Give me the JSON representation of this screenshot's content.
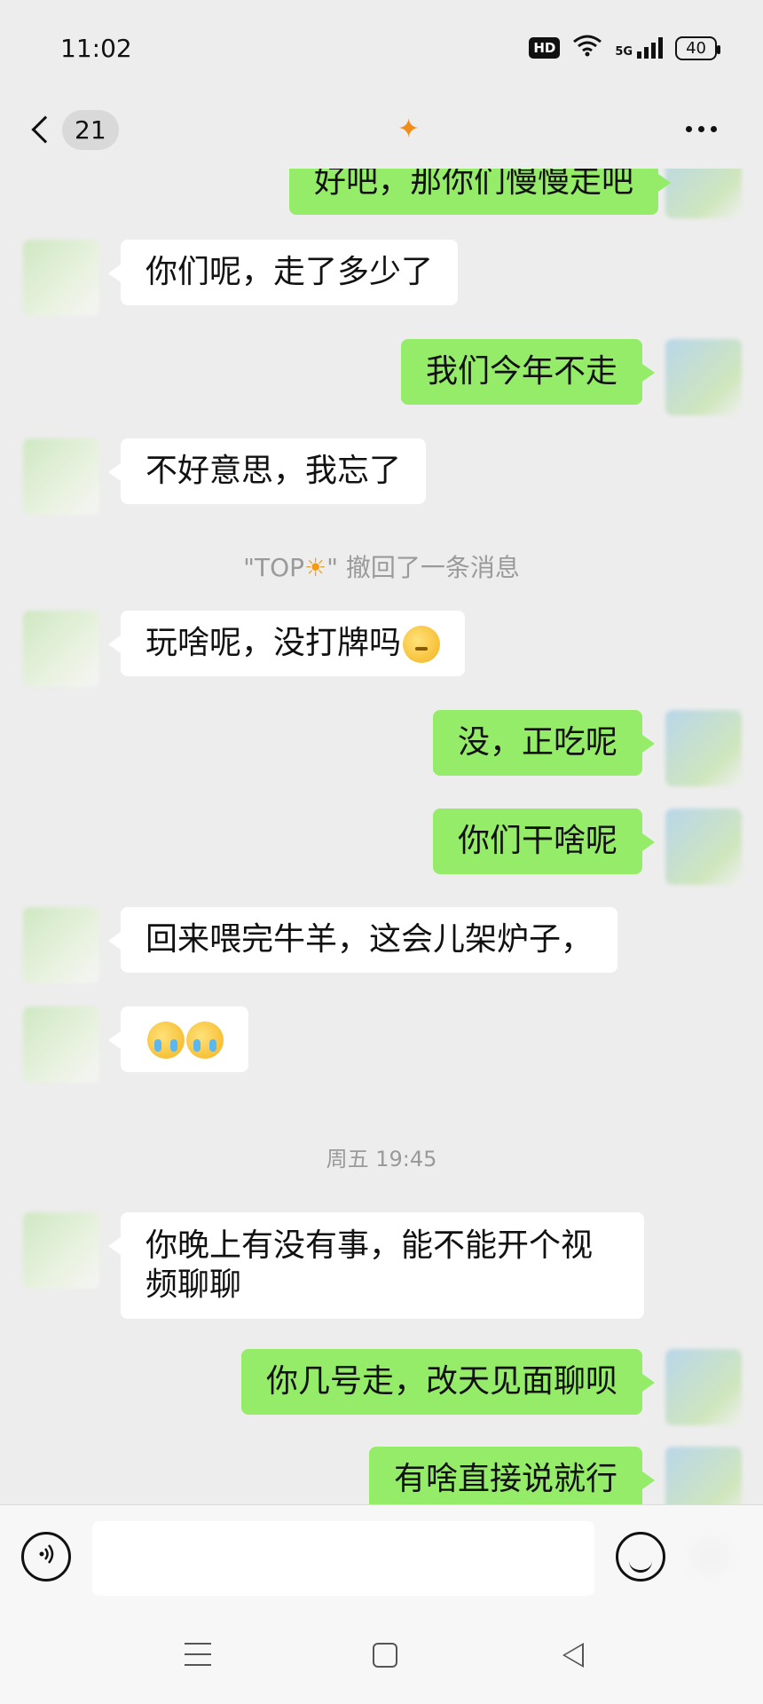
{
  "status_bar": {
    "time": "11:02",
    "hd": "HD",
    "network": "5G",
    "battery": "40"
  },
  "header": {
    "unread_count": "21",
    "title_glyph": "✦"
  },
  "messages": [
    {
      "side": "out",
      "text": "好吧，那你们慢慢走吧"
    },
    {
      "side": "in",
      "text": "你们呢，走了多少了"
    },
    {
      "side": "out",
      "text": "我们今年不走"
    },
    {
      "side": "in",
      "text": "不好意思，我忘了"
    },
    {
      "side": "system",
      "text_prefix": "\"TOP",
      "text_suffix": "\" 撤回了一条消息"
    },
    {
      "side": "in",
      "text": "玩啥呢，没打牌吗"
    },
    {
      "side": "out",
      "text": "没，正吃呢"
    },
    {
      "side": "out",
      "text": "你们干啥呢"
    },
    {
      "side": "in",
      "text": "回来喂完牛羊，这会儿架炉子，"
    },
    {
      "side": "in",
      "text": ""
    },
    {
      "side": "time",
      "text": "周五 19:45"
    },
    {
      "side": "in",
      "text": "你晚上有没有事，能不能开个视频聊聊"
    },
    {
      "side": "out",
      "text": "你几号走，改天见面聊呗"
    },
    {
      "side": "out",
      "text": "有啥直接说就行"
    }
  ],
  "input": {
    "placeholder": ""
  },
  "icons": {
    "back": "chevron-left-icon",
    "more": "more-dots-icon",
    "voice": "voice-icon",
    "emoji": "emoji-icon",
    "plus": "plus-icon",
    "sun": "sun-icon"
  },
  "colors": {
    "outgoing_bubble": "#95ec69",
    "incoming_bubble": "#ffffff",
    "background": "#ededed"
  }
}
